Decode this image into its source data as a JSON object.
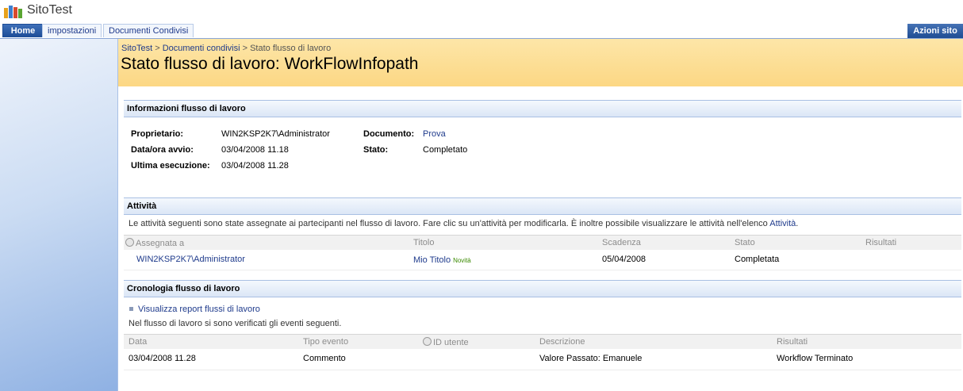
{
  "site": {
    "title": "SitoTest"
  },
  "tabs": [
    {
      "label": "Home",
      "active": true
    },
    {
      "label": "impostazioni",
      "active": false
    },
    {
      "label": "Documenti Condivisi",
      "active": false
    }
  ],
  "site_actions": "Azioni sito",
  "breadcrumb": {
    "root": "SitoTest",
    "sep": ">",
    "middle": "Documenti condivisi",
    "current": "Stato flusso di lavoro"
  },
  "page_title": "Stato flusso di lavoro: WorkFlowInfopath",
  "info": {
    "heading": "Informazioni flusso di lavoro",
    "owner_label": "Proprietario:",
    "owner_value": "WIN2KSP2K7\\Administrator",
    "start_label": "Data/ora avvio:",
    "start_value": "03/04/2008 11.18",
    "last_label": "Ultima esecuzione:",
    "last_value": "03/04/2008 11.28",
    "doc_label": "Documento:",
    "doc_value": "Prova",
    "state_label": "Stato:",
    "state_value": "Completato"
  },
  "activities": {
    "heading": "Attività",
    "desc": "Le attività seguenti sono state assegnate ai partecipanti nel flusso di lavoro. Fare clic su un'attività per modificarla. È inoltre possibile visualizzare le attività nell'elenco",
    "desc_link": "Attività",
    "desc_end": ".",
    "columns": [
      "Assegnata a",
      "Titolo",
      "Scadenza",
      "Stato",
      "Risultati"
    ],
    "rows": [
      {
        "assigned": "WIN2KSP2K7\\Administrator",
        "title": "Mio Titolo",
        "badge": "Novità",
        "due": "05/04/2008",
        "state": "Completata",
        "result": ""
      }
    ]
  },
  "history": {
    "heading": "Cronologia flusso di lavoro",
    "report_link": "Visualizza report flussi di lavoro",
    "desc": "Nel flusso di lavoro si sono verificati gli eventi seguenti.",
    "columns": [
      "Data",
      "Tipo evento",
      "ID utente",
      "Descrizione",
      "Risultati"
    ],
    "rows": [
      {
        "date": "03/04/2008 11.28",
        "type": "Commento",
        "user": "",
        "description": "Valore Passato: Emanuele",
        "result": "Workflow Terminato"
      }
    ]
  }
}
